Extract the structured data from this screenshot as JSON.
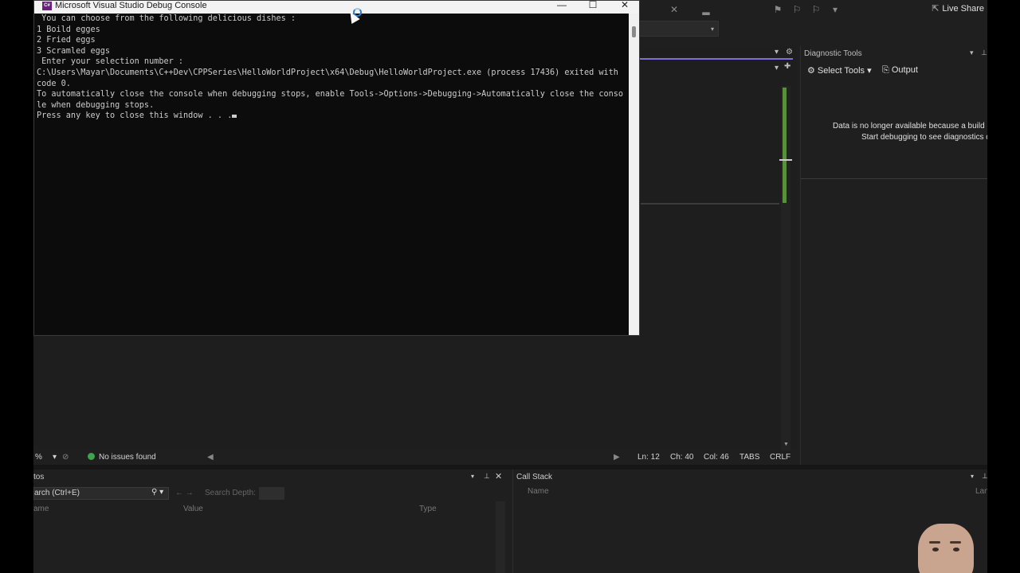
{
  "console": {
    "title": "Microsoft Visual Studio Debug Console",
    "app_icon_text": "C#",
    "lines": [
      " You can choose from the following delicious dishes :",
      "1 Boild egges",
      "2 Fried eggs",
      "3 Scramled eggs",
      " Enter your selection number :",
      "C:\\Users\\Mayar\\Documents\\C++Dev\\CPPSeries\\HelloWorldProject\\x64\\Debug\\HelloWorldProject.exe (process 17436) exited with",
      "code 0.",
      "To automatically close the console when debugging stops, enable Tools->Options->Debugging->Automatically close the conso",
      "le when debugging stops.",
      "Press any key to close this window . . ."
    ],
    "window_buttons": {
      "minimize": "—",
      "maximize": "☐",
      "close": "✕"
    }
  },
  "toolbar": {
    "live_share_label": "Live Share",
    "live_share_icon": "share-icon"
  },
  "diagnostic": {
    "title": "Diagnostic Tools",
    "select_tools_label": "Select Tools",
    "output_label": "Output",
    "message_line1": "Data is no longer available because a build has occu",
    "message_line2": "Start debugging to see diagnostics data."
  },
  "editor_status": {
    "zoom": "%",
    "issues": "No issues found",
    "ln": "Ln: 12",
    "ch": "Ch: 40",
    "col": "Col: 46",
    "tabs": "TABS",
    "eol": "CRLF"
  },
  "autos": {
    "title": "tos",
    "search_placeholder": "arch (Ctrl+E)",
    "search_depth": "Search Depth:",
    "columns": [
      "ame",
      "Value",
      "Type"
    ]
  },
  "callstack": {
    "title": "Call Stack",
    "columns": [
      "Name",
      "Lan"
    ]
  },
  "colors": {
    "console_bg": "#0c0c0c",
    "vs_bg": "#1f1f1f",
    "accent_purple": "#7c6fd8",
    "scroll_green": "#5a8f3c",
    "ok_green": "#3fa34d"
  }
}
